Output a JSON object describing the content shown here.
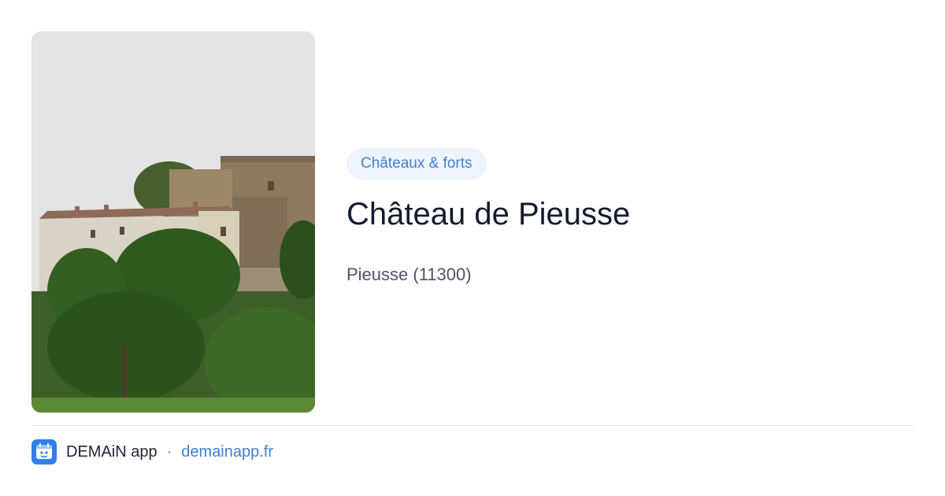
{
  "card": {
    "image": {
      "alt": "Château de Pieusse"
    },
    "category": "Châteaux & forts",
    "title": "Château de Pieusse",
    "location": "Pieusse (11300)"
  },
  "footer": {
    "app_name": "DEMAiN app",
    "separator": "·",
    "domain": "demainapp.fr",
    "logo_icon": "demain-logo-icon"
  },
  "colors": {
    "accent": "#3f7fd3",
    "chip_background": "#eef4fd",
    "title": "#131b2e",
    "subtitle": "#4b5466",
    "logo": "#2f80e8"
  }
}
